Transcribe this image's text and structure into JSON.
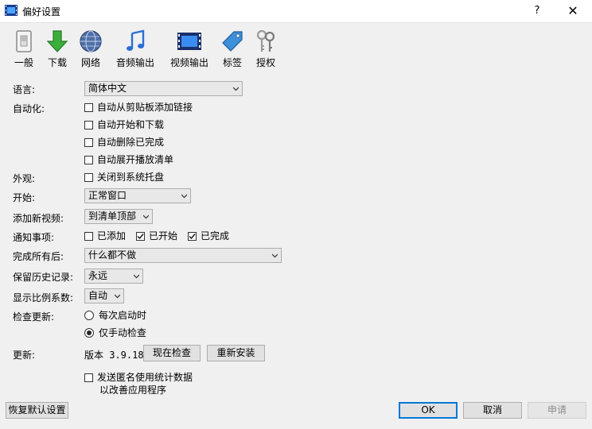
{
  "window": {
    "title": "偏好设置",
    "help": "?",
    "close": "✕"
  },
  "toolbar": [
    {
      "label": "一般",
      "icon": "switch-icon"
    },
    {
      "label": "下载",
      "icon": "download-arrow-icon"
    },
    {
      "label": "网络",
      "icon": "globe-icon"
    },
    {
      "label": "音频输出",
      "icon": "music-note-icon"
    },
    {
      "label": "视频输出",
      "icon": "film-strip-icon"
    },
    {
      "label": "标签",
      "icon": "tag-icon"
    },
    {
      "label": "授权",
      "icon": "keys-icon"
    }
  ],
  "language": {
    "label": "语言:",
    "value": "简体中文"
  },
  "automation": {
    "label": "自动化:",
    "options": [
      {
        "label": "自动从剪贴板添加链接",
        "checked": false
      },
      {
        "label": "自动开始和下载",
        "checked": false
      },
      {
        "label": "自动删除已完成",
        "checked": false
      },
      {
        "label": "自动展开播放清单",
        "checked": false
      }
    ]
  },
  "appearance": {
    "label": "外观:",
    "option": {
      "label": "关闭到系统托盘",
      "checked": false
    }
  },
  "startup": {
    "label": "开始:",
    "value": "正常窗口"
  },
  "add_new_video": {
    "label": "添加新视频:",
    "value": "到清单顶部"
  },
  "notifications": {
    "label": "通知事项:",
    "options": [
      {
        "label": "已添加",
        "checked": false
      },
      {
        "label": "已开始",
        "checked": true
      },
      {
        "label": "已完成",
        "checked": true
      }
    ]
  },
  "after_all_done": {
    "label": "完成所有后:",
    "value": "什么都不做"
  },
  "keep_history": {
    "label": "保留历史记录:",
    "value": "永远"
  },
  "scale_factor": {
    "label": "显示比例系数:",
    "value": "自动"
  },
  "check_updates": {
    "label": "检查更新:",
    "options": [
      {
        "label": "每次启动时",
        "selected": false
      },
      {
        "label": "仅手动检查",
        "selected": true
      }
    ]
  },
  "update": {
    "label": "更新:",
    "version": "版本 3.9.18",
    "check_now": "现在检查",
    "reinstall": "重新安装"
  },
  "stats": {
    "line1": "发送匿名使用统计数据",
    "line2": "以改善应用程序",
    "checked": false
  },
  "footer": {
    "restore_defaults": "恢复默认设置",
    "ok": "OK",
    "cancel": "取消",
    "apply": "申请"
  },
  "colors": {
    "accent": "#0078d7",
    "background": "#f0f0f0",
    "button": "#e1e1e1"
  }
}
